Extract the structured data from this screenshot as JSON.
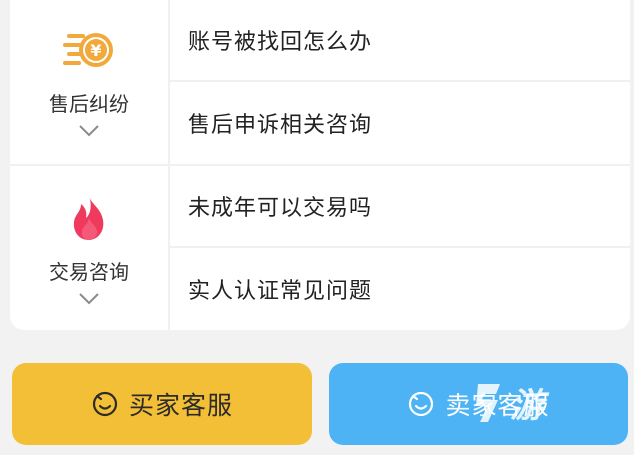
{
  "categories": [
    {
      "label": "售后纠纷",
      "icon": "coin-yen-icon",
      "questions": [
        "账号被找回怎么办",
        "售后申诉相关咨询"
      ]
    },
    {
      "label": "交易咨询",
      "icon": "flame-icon",
      "questions": [
        "未成年可以交易吗",
        "实人认证常见问题"
      ]
    }
  ],
  "buttons": {
    "buyer": "买家客服",
    "seller": "卖家客服"
  },
  "watermark": "游",
  "colors": {
    "buyer_button": "#f3bf36",
    "seller_button": "#4db3f5",
    "coin_icon": "#f2a93b",
    "flame_icon": "#ef3a5d"
  }
}
